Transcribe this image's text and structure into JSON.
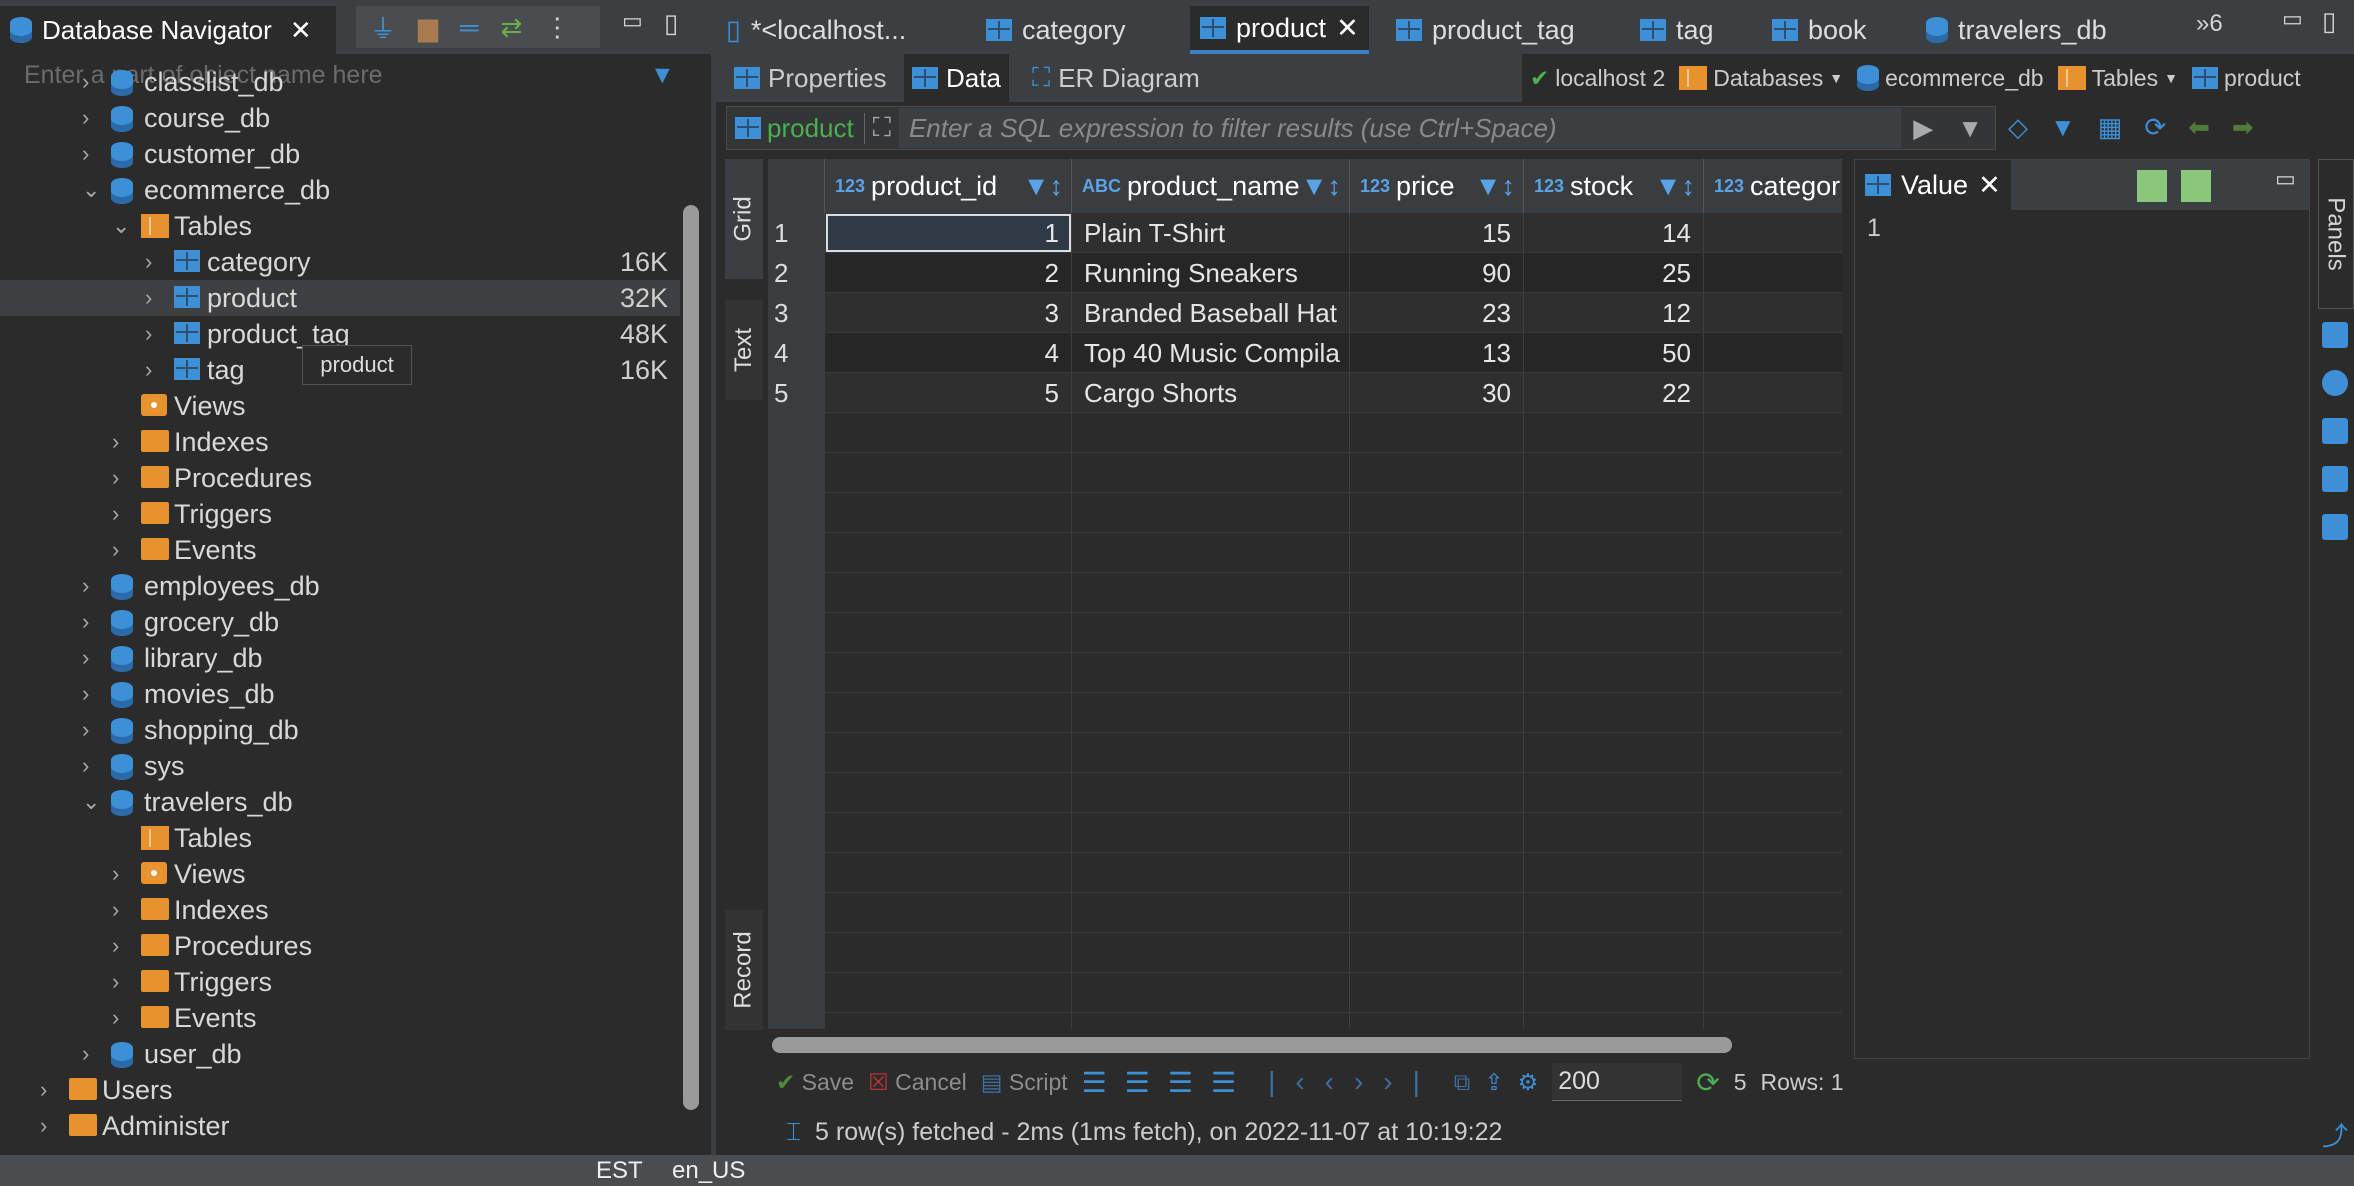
{
  "navigator": {
    "title": "Database Navigator",
    "search_placeholder": "Enter a part of object name here",
    "tree": [
      {
        "label": "classlist_db",
        "level": 1,
        "type": "db",
        "chev": "›"
      },
      {
        "label": "course_db",
        "level": 1,
        "type": "db",
        "chev": "›"
      },
      {
        "label": "customer_db",
        "level": 1,
        "type": "db",
        "chev": "›"
      },
      {
        "label": "ecommerce_db",
        "level": 1,
        "type": "db",
        "chev": "⌄"
      },
      {
        "label": "Tables",
        "level": 2,
        "type": "otbl",
        "chev": "⌄"
      },
      {
        "label": "category",
        "level": 3,
        "type": "tbl",
        "chev": "›",
        "size": "16K"
      },
      {
        "label": "product",
        "level": 3,
        "type": "tbl",
        "chev": "›",
        "size": "32K",
        "selected": true
      },
      {
        "label": "product_tag",
        "level": 3,
        "type": "tbl",
        "chev": "›",
        "size": "48K"
      },
      {
        "label": "tag",
        "level": 3,
        "type": "tbl",
        "chev": "›",
        "size": "16K"
      },
      {
        "label": "Views",
        "level": 2,
        "type": "views",
        "chev": ""
      },
      {
        "label": "Indexes",
        "level": 2,
        "type": "folder",
        "chev": "›"
      },
      {
        "label": "Procedures",
        "level": 2,
        "type": "folder",
        "chev": "›"
      },
      {
        "label": "Triggers",
        "level": 2,
        "type": "folder",
        "chev": "›"
      },
      {
        "label": "Events",
        "level": 2,
        "type": "folder",
        "chev": "›"
      },
      {
        "label": "employees_db",
        "level": 1,
        "type": "db",
        "chev": "›"
      },
      {
        "label": "grocery_db",
        "level": 1,
        "type": "db",
        "chev": "›"
      },
      {
        "label": "library_db",
        "level": 1,
        "type": "db",
        "chev": "›"
      },
      {
        "label": "movies_db",
        "level": 1,
        "type": "db",
        "chev": "›"
      },
      {
        "label": "shopping_db",
        "level": 1,
        "type": "db",
        "chev": "›"
      },
      {
        "label": "sys",
        "level": 1,
        "type": "db",
        "chev": "›"
      },
      {
        "label": "travelers_db",
        "level": 1,
        "type": "db",
        "chev": "⌄"
      },
      {
        "label": "Tables",
        "level": 2,
        "type": "otbl",
        "chev": ""
      },
      {
        "label": "Views",
        "level": 2,
        "type": "views",
        "chev": "›"
      },
      {
        "label": "Indexes",
        "level": 2,
        "type": "folder",
        "chev": "›"
      },
      {
        "label": "Procedures",
        "level": 2,
        "type": "folder",
        "chev": "›"
      },
      {
        "label": "Triggers",
        "level": 2,
        "type": "folder",
        "chev": "›"
      },
      {
        "label": "Events",
        "level": 2,
        "type": "folder",
        "chev": "›"
      },
      {
        "label": "user_db",
        "level": 1,
        "type": "db",
        "chev": "›"
      },
      {
        "label": "Users",
        "level": 0,
        "type": "folder",
        "chev": "›"
      },
      {
        "label": "Administer",
        "level": 0,
        "type": "folder",
        "chev": "›"
      }
    ],
    "tooltip": "product"
  },
  "editor_tabs": [
    {
      "label": "*<localhost...",
      "icon": "sql"
    },
    {
      "label": "category",
      "icon": "tbl"
    },
    {
      "label": "product",
      "icon": "tbl",
      "active": true
    },
    {
      "label": "product_tag",
      "icon": "tbl"
    },
    {
      "label": "tag",
      "icon": "tbl"
    },
    {
      "label": "book",
      "icon": "tbl"
    },
    {
      "label": "travelers_db",
      "icon": "db"
    }
  ],
  "more_tabs": "»6",
  "sub_tabs": [
    "Properties",
    "Data",
    "ER Diagram"
  ],
  "breadcrumb": [
    "localhost 2",
    "Databases",
    "ecommerce_db",
    "Tables",
    "product"
  ],
  "filter": {
    "entity": "product",
    "placeholder": "Enter a SQL expression to filter results (use Ctrl+Space)"
  },
  "side_tabs": [
    "Grid",
    "Text",
    "Record"
  ],
  "grid": {
    "columns": [
      {
        "type": "123",
        "name": "product_id"
      },
      {
        "type": "ABC",
        "name": "product_name"
      },
      {
        "type": "123",
        "name": "price"
      },
      {
        "type": "123",
        "name": "stock"
      },
      {
        "type": "123",
        "name": "categor"
      }
    ],
    "rows": [
      [
        "1",
        "1",
        "Plain T-Shirt",
        "15",
        "14"
      ],
      [
        "2",
        "2",
        "Running Sneakers",
        "90",
        "25"
      ],
      [
        "3",
        "3",
        "Branded Baseball Hat",
        "23",
        "12"
      ],
      [
        "4",
        "4",
        "Top 40 Music Compila",
        "13",
        "50"
      ],
      [
        "5",
        "5",
        "Cargo Shorts",
        "30",
        "22"
      ]
    ]
  },
  "value_panel": {
    "title": "Value",
    "content": "1"
  },
  "right_panel_label": "Panels",
  "bottom_toolbar": {
    "save": "Save",
    "cancel": "Cancel",
    "script": "Script",
    "fetch_size": "200",
    "count": "5",
    "rows": "Rows: 1"
  },
  "status": "5 row(s) fetched - 2ms (1ms fetch), on 2022-11-07 at 10:19:22",
  "statusbar": {
    "tz": "EST",
    "locale": "en_US"
  }
}
